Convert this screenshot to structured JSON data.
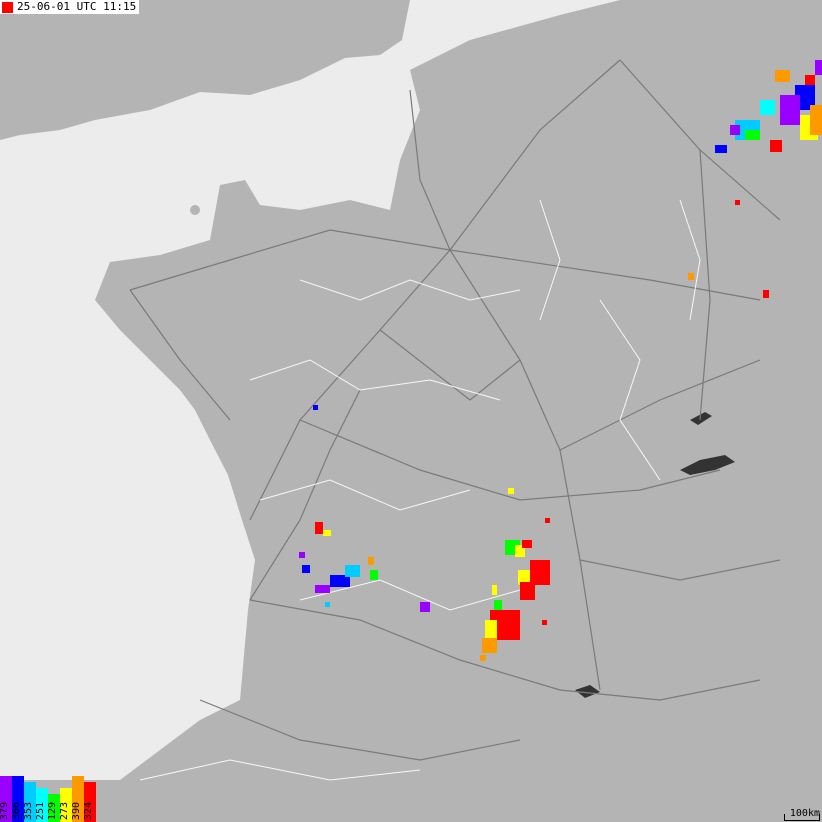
{
  "header": {
    "timestamp": "25-06-01 UTC 11:15",
    "marker_color": "#ff0000"
  },
  "legend": [
    {
      "value": "379",
      "color": "#9900ff"
    },
    {
      "value": "366",
      "color": "#0000ff"
    },
    {
      "value": "353",
      "color": "#00ccff"
    },
    {
      "value": "251",
      "color": "#00ffff"
    },
    {
      "value": "129",
      "color": "#00ff00"
    },
    {
      "value": "273",
      "color": "#ffff00"
    },
    {
      "value": "390",
      "color": "#ff9900"
    },
    {
      "value": "324",
      "color": "#ff0000"
    }
  ],
  "scale": {
    "label": "100km"
  },
  "colors": {
    "sea": "#ececec",
    "land": "#b4b4b4",
    "roads": "#7a7a7a",
    "borders": "#ffffff"
  }
}
